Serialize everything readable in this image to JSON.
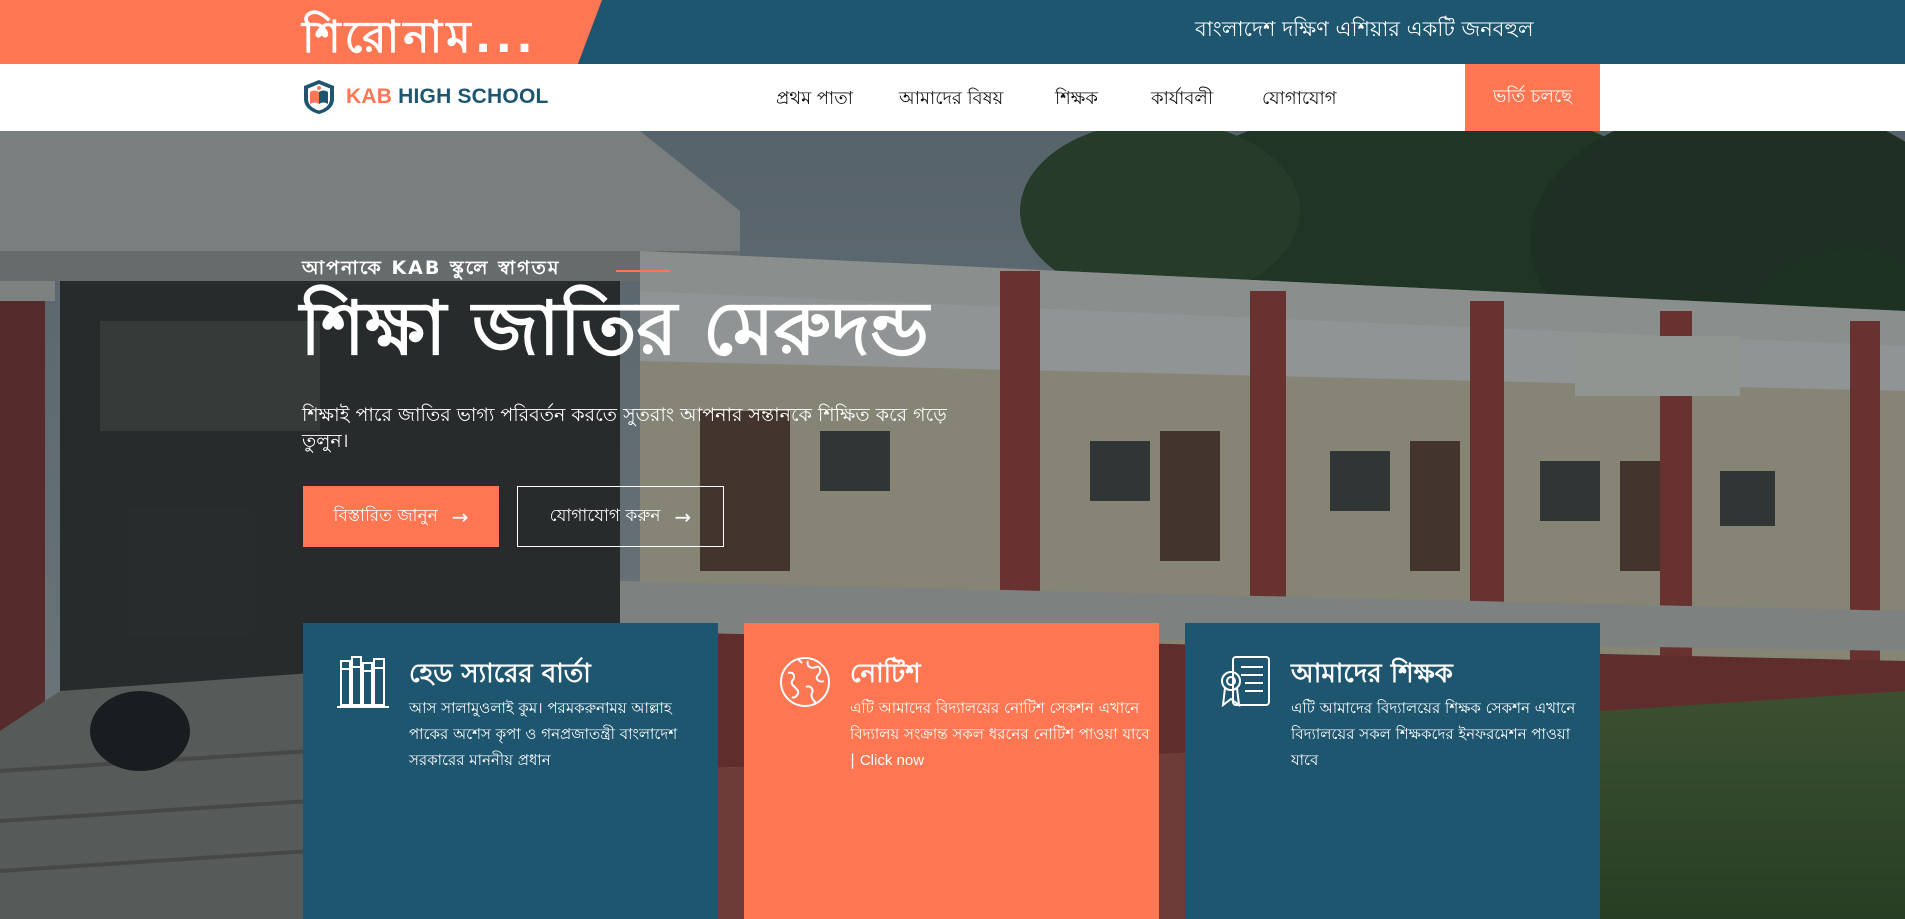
{
  "topbar": {
    "headline": "শিরোনাম...",
    "marquee": "বাংলাদেশ দক্ষিণ এশিয়ার একটি জনবহুল"
  },
  "navbar": {
    "logo": {
      "prefix": "KAB",
      "suffix": " HIGH SCHOOL",
      "icon": "school-book-icon"
    },
    "links": [
      {
        "label": "প্রথম পাতা"
      },
      {
        "label": "আমাদের বিষয়"
      },
      {
        "label": "শিক্ষক"
      },
      {
        "label": "কার্যাবলী"
      },
      {
        "label": "যোগাযোগ"
      }
    ],
    "cta": "ভর্তি চলছে"
  },
  "hero": {
    "subtitle": "আপনাকে KAB স্কুলে স্বাগতম",
    "title": "শিক্ষা জাতির মেরুদন্ড",
    "description": "শিক্ষাই পারে জাতির ভাগ্য পরিবর্তন করতে সুতরাং আপনার সন্তানকে শিক্ষিত করে গড়ে তুলুন।",
    "buttons": {
      "primary": "বিস্তারিত জানুন",
      "secondary": "যোগাযোগ করুন",
      "arrow": "→"
    }
  },
  "cards": [
    {
      "title": "হেড স্যারের বার্তা",
      "body": "আস সালামুওলাই কুম। পরমকরুনাময় আল্লাহ পাকের অশেস কৃপা ও গনপ্রজাতন্ত্রী বাংলাদেশ সরকারের মাননীয় প্রধান",
      "icon": "books-icon"
    },
    {
      "title": "নোটিশ",
      "body": "এটি আমাদের বিদ্যালয়ের নোটিশ সেকশন এখানে বিদ্যালয় সংক্রান্ত সকল ধরনের নোটিশ পাওয়া যাবে |",
      "link": "Click now",
      "icon": "globe-icon"
    },
    {
      "title": "আমাদের শিক্ষক",
      "body": "এটি আমাদের বিদ্যালয়ের শিক্ষক সেকশন এখানে বিদ্যালয়ের সকল শিক্ষকদের ইনফরমেশন পাওয়া যাবে",
      "icon": "certificate-icon"
    }
  ],
  "colors": {
    "primary": "#fe7652",
    "secondary": "#1e5670"
  }
}
